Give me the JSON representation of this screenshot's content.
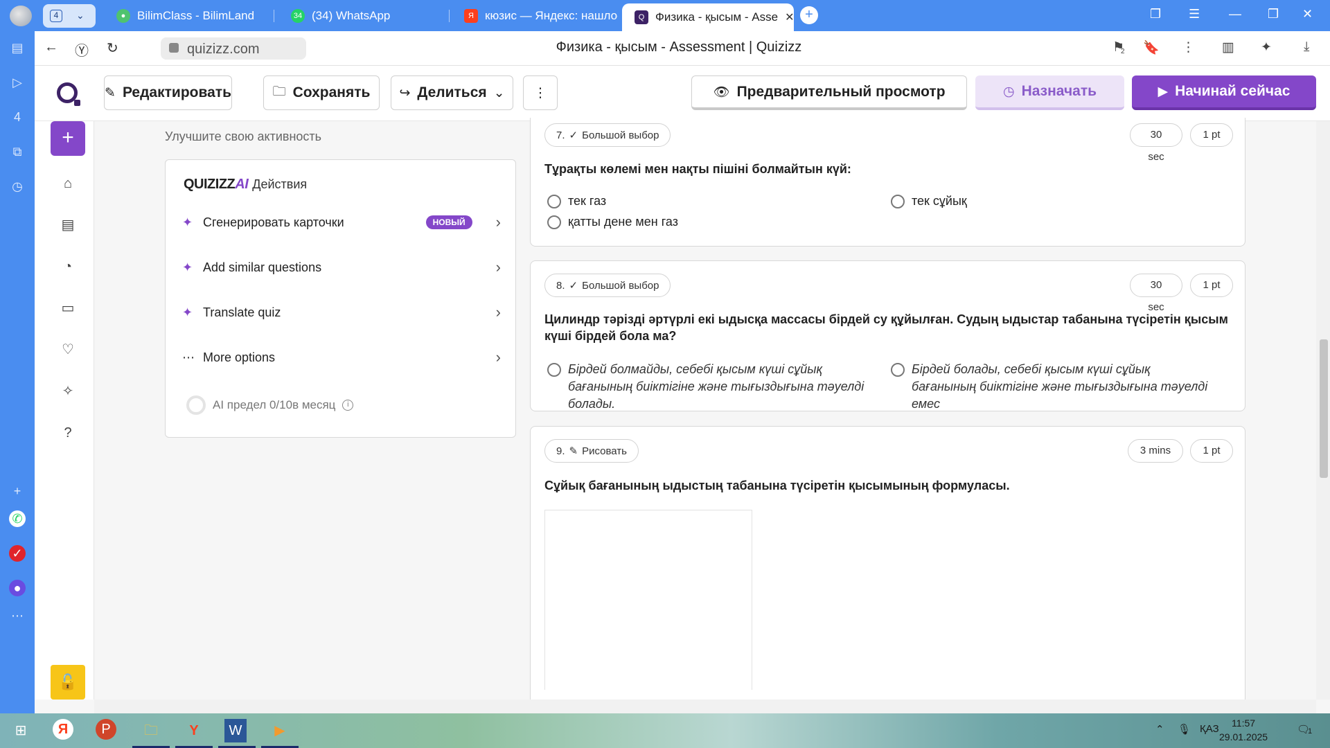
{
  "browser": {
    "tab_count": "4",
    "tabs": [
      {
        "title": "BilimClass - BilimLand",
        "favicon_color": "#4fc36f"
      },
      {
        "title": "(34) WhatsApp",
        "favicon_color": "#25d366",
        "badge": "34"
      },
      {
        "title": "кюзис — Яндекс: нашлось",
        "favicon_color": "#fc3f1d"
      },
      {
        "title": "Физика - қысым - Asse",
        "favicon_color": "#3d2266"
      }
    ],
    "url": "quizizz.com",
    "page_title": "Физика - қысым - Assessment | Quizizz",
    "extension_badge": "2"
  },
  "header": {
    "edit_label": "Редактировать",
    "save_label": "Сохранять",
    "share_label": "Делиться",
    "preview_label": "Предварительный просмотр",
    "assign_label": "Назначать",
    "start_label": "Начинай сейчас"
  },
  "activity": {
    "heading": "Улучшите свою активность",
    "ai_logo": "QUIZIZZ",
    "ai_logo_suffix": "AI",
    "ai_title": "Действия",
    "items": [
      {
        "label": "Сгенерировать карточки",
        "badge": "НОВЫЙ"
      },
      {
        "label": "Add similar questions"
      },
      {
        "label": "Translate quiz"
      },
      {
        "label": "More options"
      }
    ],
    "ai_limit": "AI предел 0/10в месяц"
  },
  "questions": [
    {
      "number": "7.",
      "type": "Большой выбор",
      "time": "30 sec",
      "points": "1 pt",
      "text": "Тұрақты көлемі мен нақты пішіні болмайтын күй:",
      "options": [
        "тек газ",
        "тек сұйық",
        "қатты дене мен газ"
      ]
    },
    {
      "number": "8.",
      "type": "Большой выбор",
      "time": "30 sec",
      "points": "1 pt",
      "text": "Цилиндр тәрізді әртүрлі екі ыдысқа массасы бірдей су құйылған. Судың ыдыстар табанына түсіретін қысым күші бірдей бола ма?",
      "options": [
        "Бірдей болмайды, себебі қысым күші сұйық бағанының биіктігіне  және тығыздығына тәуелді болады.",
        "Бірдей болады, себебі қысым күші сұйық бағанының биіктігіне  және тығыздығына тәуелді емес"
      ]
    },
    {
      "number": "9.",
      "type": "Рисовать",
      "time": "3 mins",
      "points": "1 pt",
      "text": "Сұйық бағанының ыдыстың табанына түсіретін қысымының формуласы."
    }
  ],
  "taskbar": {
    "lang": "ҚАЗ",
    "time": "11:57",
    "date": "29.01.2025",
    "notifications": "1"
  },
  "colors": {
    "accent": "#8447c9",
    "browser_blue": "#4a8df0",
    "lock_yellow": "#f7c518"
  }
}
